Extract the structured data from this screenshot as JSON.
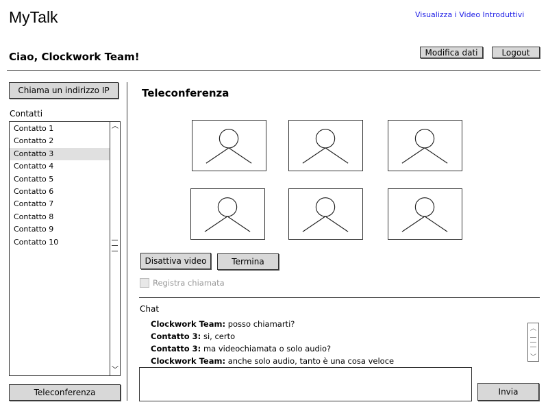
{
  "app": {
    "title": "MyTalk",
    "intro_link": "Visualizza i Video Introduttivi"
  },
  "header": {
    "greeting": "Ciao, Clockwork Team!",
    "edit_label": "Modifica dati",
    "logout_label": "Logout"
  },
  "sidebar": {
    "call_ip_label": "Chiama un indirizzo IP",
    "contacts_heading": "Contatti",
    "contacts": [
      "Contatto 1",
      "Contatto 2",
      "Contatto 3",
      "Contatto 4",
      "Contatto 5",
      "Contatto 6",
      "Contatto 7",
      "Contatto 8",
      "Contatto 9",
      "Contatto 10"
    ],
    "selected_contact": "Contatto 3",
    "teleconference_label": "Teleconferenza"
  },
  "main": {
    "title": "Teleconferenza",
    "participant_count": 6,
    "disable_video_label": "Disattiva video",
    "end_label": "Termina",
    "record_label": "Registra chiamata",
    "record_checked": false
  },
  "chat": {
    "heading": "Chat",
    "messages": [
      {
        "sender": "Clockwork Team:",
        "text": "posso chiamarti?"
      },
      {
        "sender": "Contatto 3:",
        "text": "si, certo"
      },
      {
        "sender": "Contatto 3:",
        "text": "ma videochiamata o solo audio?"
      },
      {
        "sender": "Clockwork Team:",
        "text": "anche solo audio, tanto è una cosa veloce"
      }
    ],
    "input_value": "",
    "send_label": "Invia"
  }
}
